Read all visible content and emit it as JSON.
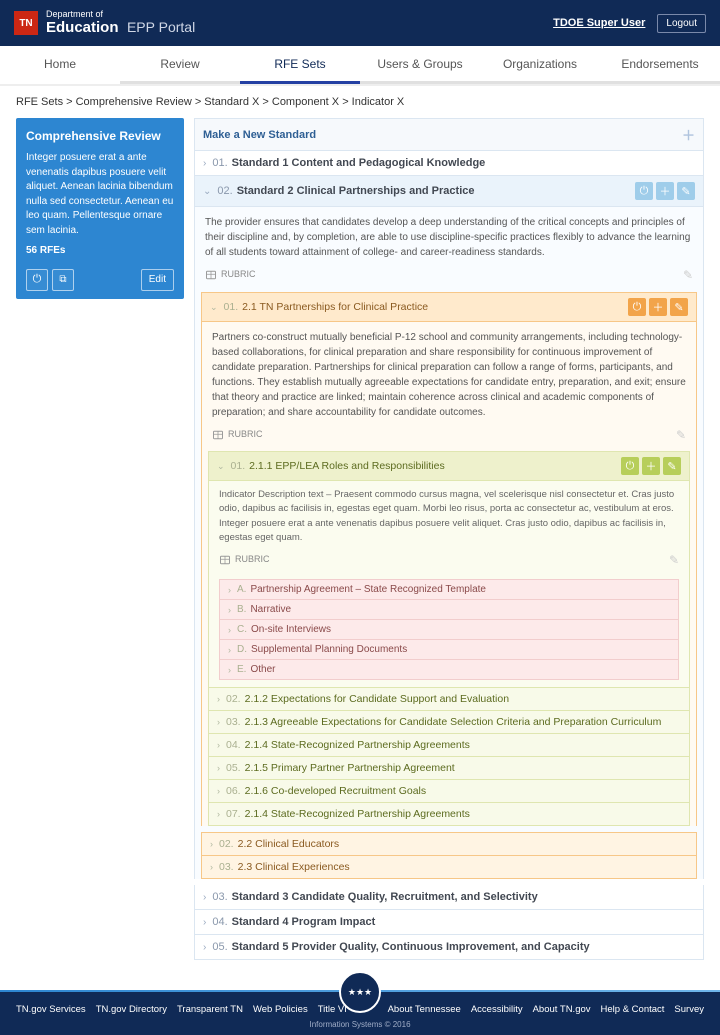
{
  "header": {
    "tn": "TN",
    "dept": "Department of",
    "edu": "Education",
    "portal": "EPP Portal",
    "user": "TDOE Super User",
    "logout": "Logout"
  },
  "tabs": [
    "Home",
    "Review",
    "RFE Sets",
    "Users & Groups",
    "Organizations",
    "Endorsements"
  ],
  "activeTab": 2,
  "breadcrumb": "RFE Sets > Comprehensive Review > Standard X > Component X > Indicator X",
  "side": {
    "title": "Comprehensive Review",
    "body": "Integer posuere erat a ante venenatis dapibus posuere velit aliquet. Aenean lacinia bibendum nulla sed consectetur. Aenean eu leo quam. Pellentesque ornare sem lacinia.",
    "rfes": "56 RFEs",
    "edit": "Edit"
  },
  "make": "Make a New Standard",
  "rubric": "RUBRIC",
  "standards": {
    "s1": {
      "num": "01.",
      "title": "Standard 1 Content and Pedagogical Knowledge"
    },
    "s2": {
      "num": "02.",
      "title": "Standard 2 Clinical Partnerships and Practice",
      "desc": "The provider ensures that candidates develop a deep understanding of the critical concepts and principles of their discipline and, by completion, are able to use discipline-specific practices flexibly to advance the learning of all students toward attainment of college- and career-readiness standards."
    },
    "s3": {
      "num": "03.",
      "title": "Standard 3 Candidate Quality, Recruitment, and Selectivity"
    },
    "s4": {
      "num": "04.",
      "title": "Standard 4 Program Impact"
    },
    "s5": {
      "num": "05.",
      "title": "Standard 5 Provider Quality, Continuous Improvement, and Capacity"
    }
  },
  "components": {
    "c1": {
      "num": "01.",
      "title": "2.1 TN Partnerships for Clinical Practice",
      "desc": "Partners co-construct mutually beneficial P-12 school and community arrangements, including technology-based collaborations, for clinical preparation and share responsibility for continuous improvement of candidate preparation. Partnerships for clinical preparation can follow a range of forms, participants, and functions. They establish mutually agreeable expectations for candidate entry, preparation, and exit; ensure that theory and practice are linked; maintain coherence across clinical and academic components of preparation; and share accountability for candidate outcomes."
    },
    "c2": {
      "num": "02.",
      "title": "2.2 Clinical Educators"
    },
    "c3": {
      "num": "03.",
      "title": "2.3 Clinical Experiences"
    }
  },
  "indicators": {
    "i1": {
      "num": "01.",
      "title": "2.1.1 EPP/LEA Roles and Responsibilities",
      "desc": "Indicator Description text – Praesent commodo cursus magna, vel scelerisque nisl consectetur et. Cras justo odio, dapibus ac facilisis in, egestas eget quam. Morbi leo risus, porta ac consectetur ac, vestibulum at eros. Integer posuere erat a ante venenatis dapibus posuere velit aliquet. Cras justo odio, dapibus ac facilisis in, egestas eget quam."
    },
    "i2": {
      "num": "02.",
      "title": "2.1.2 Expectations for Candidate Support and Evaluation"
    },
    "i3": {
      "num": "03.",
      "title": "2.1.3 Agreeable Expectations for Candidate Selection Criteria and Preparation Curriculum"
    },
    "i4": {
      "num": "04.",
      "title": "2.1.4 State-Recognized Partnership Agreements"
    },
    "i5": {
      "num": "05.",
      "title": "2.1.5 Primary Partner Partnership Agreement"
    },
    "i6": {
      "num": "06.",
      "title": "2.1.6 Co-developed Recruitment Goals"
    },
    "i7": {
      "num": "07.",
      "title": "2.1.4 State-Recognized Partnership Agreements"
    }
  },
  "items": {
    "a": {
      "num": "A.",
      "title": "Partnership Agreement – State Recognized Template"
    },
    "b": {
      "num": "B.",
      "title": "Narrative"
    },
    "c": {
      "num": "C.",
      "title": "On-site Interviews"
    },
    "d": {
      "num": "D.",
      "title": "Supplemental Planning Documents"
    },
    "e": {
      "num": "E.",
      "title": "Other"
    }
  },
  "footer": {
    "left": [
      "TN.gov Services",
      "TN.gov Directory",
      "Transparent TN",
      "Web Policies",
      "Title VI"
    ],
    "right": [
      "About Tennessee",
      "Accessibility",
      "About TN.gov",
      "Help & Contact",
      "Survey"
    ],
    "meta": "Information Systems © 2016"
  }
}
